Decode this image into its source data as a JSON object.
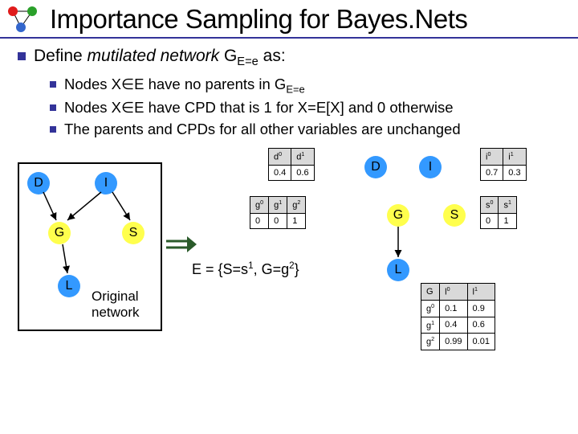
{
  "title": "Importance Sampling for Bayes.Nets",
  "main_bullet_pre": "Define ",
  "main_bullet_em": "mutilated network",
  "main_bullet_post": " G",
  "main_bullet_sub": "E=e",
  "main_bullet_end": " as:",
  "sub": {
    "a_pre": "Nodes X",
    "a_mid": "E have no parents in G",
    "a_sub": "E=e",
    "b_pre": "Nodes X",
    "b_post": "E have CPD that is 1 for X=E[X] and 0 otherwise",
    "c": "The parents and CPDs for all other variables are unchanged"
  },
  "nodes": {
    "D": "D",
    "I": "I",
    "G": "G",
    "S": "S",
    "L": "L"
  },
  "orig_label_1": "Original",
  "orig_label_2": "network",
  "evidence_pre": "E = {S=s",
  "evidence_mid": ", G=g",
  "evidence_end": "}",
  "evidence_sup1": "1",
  "evidence_sup2": "2",
  "d_tbl": {
    "h0": "d",
    "h0s": "0",
    "h1": "d",
    "h1s": "1",
    "v0": "0.4",
    "v1": "0.6"
  },
  "i_tbl": {
    "h0": "i",
    "h0s": "0",
    "h1": "i",
    "h1s": "1",
    "v0": "0.7",
    "v1": "0.3"
  },
  "g_tbl": {
    "h0": "g",
    "h0s": "0",
    "h1": "g",
    "h1s": "1",
    "h2": "g",
    "h2s": "2",
    "v0": "0",
    "v1": "0",
    "v2": "1"
  },
  "s_tbl": {
    "h0": "s",
    "h0s": "0",
    "h1": "s",
    "h1s": "1",
    "v0": "0",
    "v1": "1"
  },
  "l_tbl": {
    "hG": "G",
    "hl0": "l",
    "hl0s": "0",
    "hl1": "l",
    "hl1s": "1",
    "r0g": "g",
    "r0gs": "0",
    "r0a": "0.1",
    "r0b": "0.9",
    "r1g": "g",
    "r1gs": "1",
    "r1a": "0.4",
    "r1b": "0.6",
    "r2g": "g",
    "r2gs": "2",
    "r2a": "0.99",
    "r2b": "0.01"
  },
  "chart_data": {
    "type": "table",
    "semantics": "Bayesian network CPDs after mutilation for evidence E={S=s1,G=g2}",
    "P_D": {
      "d0": 0.4,
      "d1": 0.6
    },
    "P_I": {
      "i0": 0.7,
      "i1": 0.3
    },
    "P_G_mutilated": {
      "g0": 0,
      "g1": 0,
      "g2": 1
    },
    "P_S_mutilated": {
      "s0": 0,
      "s1": 1
    },
    "P_L_given_G": {
      "g0": {
        "l0": 0.1,
        "l1": 0.9
      },
      "g1": {
        "l0": 0.4,
        "l1": 0.6
      },
      "g2": {
        "l0": 0.99,
        "l1": 0.01
      }
    },
    "original_network_edges": [
      "D->G",
      "I->G",
      "I->S",
      "G->L"
    ],
    "mutilated_network_edges": [
      "G->L"
    ],
    "evidence": {
      "S": "s1",
      "G": "g2"
    }
  }
}
